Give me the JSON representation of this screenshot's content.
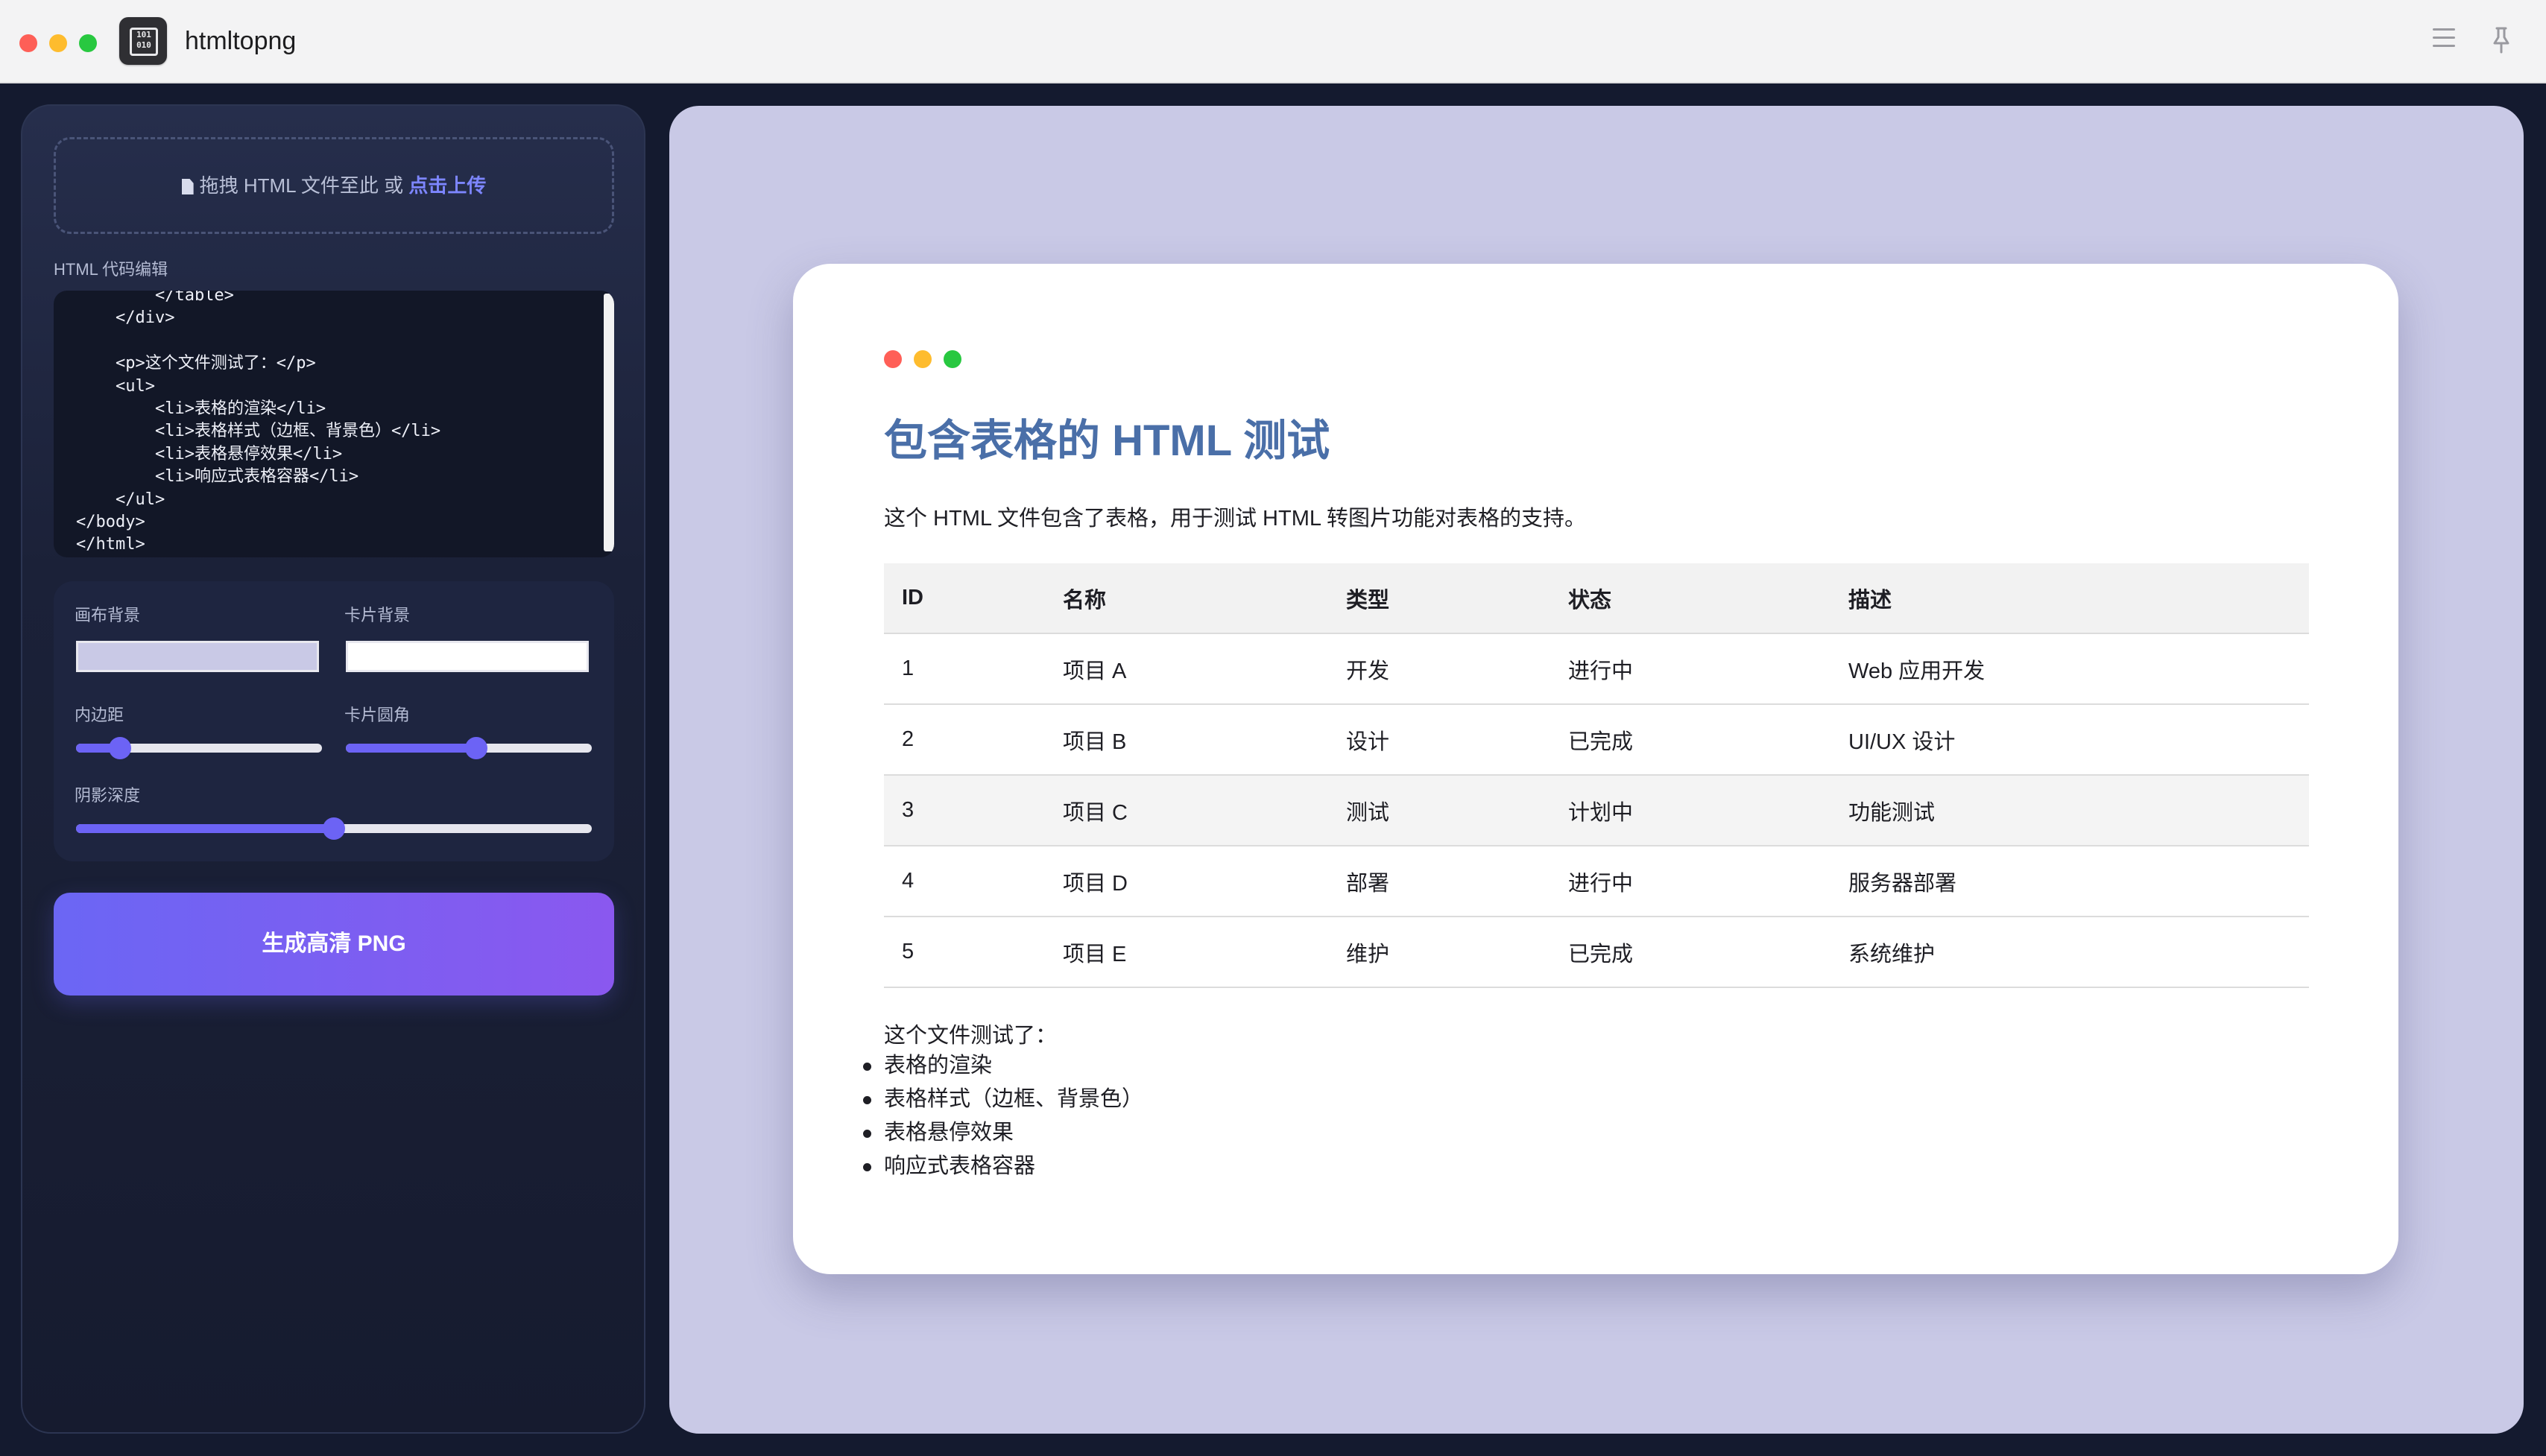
{
  "app": {
    "title": "htmltopng",
    "icon_glyph": "101\n010",
    "icon_name": "binary-app-icon",
    "menu_icon": "hamburger-menu-icon",
    "pin_icon": "pin-icon"
  },
  "editor": {
    "dropzone": {
      "text": "拖拽 HTML 文件至此 或 ",
      "link": "点击上传"
    },
    "code_label": "HTML 代码编辑",
    "code": "        </table>\n    </div>\n\n    <p>这个文件测试了：</p>\n    <ul>\n        <li>表格的渲染</li>\n        <li>表格样式（边框、背景色）</li>\n        <li>表格悬停效果</li>\n        <li>响应式表格容器</li>\n    </ul>\n</body>\n</html>"
  },
  "settings": {
    "canvas_bg": {
      "label": "画布背景",
      "value": "#c9c9e6"
    },
    "card_bg": {
      "label": "卡片背景",
      "value": "#ffffff"
    },
    "padding": {
      "label": "内边距",
      "level": 0.18
    },
    "radius": {
      "label": "卡片圆角",
      "level": 0.53
    },
    "shadow": {
      "label": "阴影深度",
      "level": 0.5
    },
    "generate_label": "生成高清 PNG"
  },
  "preview": {
    "dots": [
      "#ff5f57",
      "#febc2e",
      "#28c840"
    ],
    "title": "包含表格的 HTML 测试",
    "intro": "这个 HTML 文件包含了表格，用于测试 HTML 转图片功能对表格的支持。",
    "table": {
      "headers": [
        "ID",
        "名称",
        "类型",
        "状态",
        "描述"
      ],
      "rows": [
        [
          "1",
          "项目 A",
          "开发",
          "进行中",
          "Web 应用开发"
        ],
        [
          "2",
          "项目 B",
          "设计",
          "已完成",
          "UI/UX 设计"
        ],
        [
          "3",
          "项目 C",
          "测试",
          "计划中",
          "功能测试"
        ],
        [
          "4",
          "项目 D",
          "部署",
          "进行中",
          "服务器部署"
        ],
        [
          "5",
          "项目 E",
          "维护",
          "已完成",
          "系统维护"
        ]
      ]
    },
    "list_title": "这个文件测试了：",
    "list": [
      "表格的渲染",
      "表格样式（边框、背景色）",
      "表格悬停效果",
      "响应式表格容器"
    ]
  }
}
